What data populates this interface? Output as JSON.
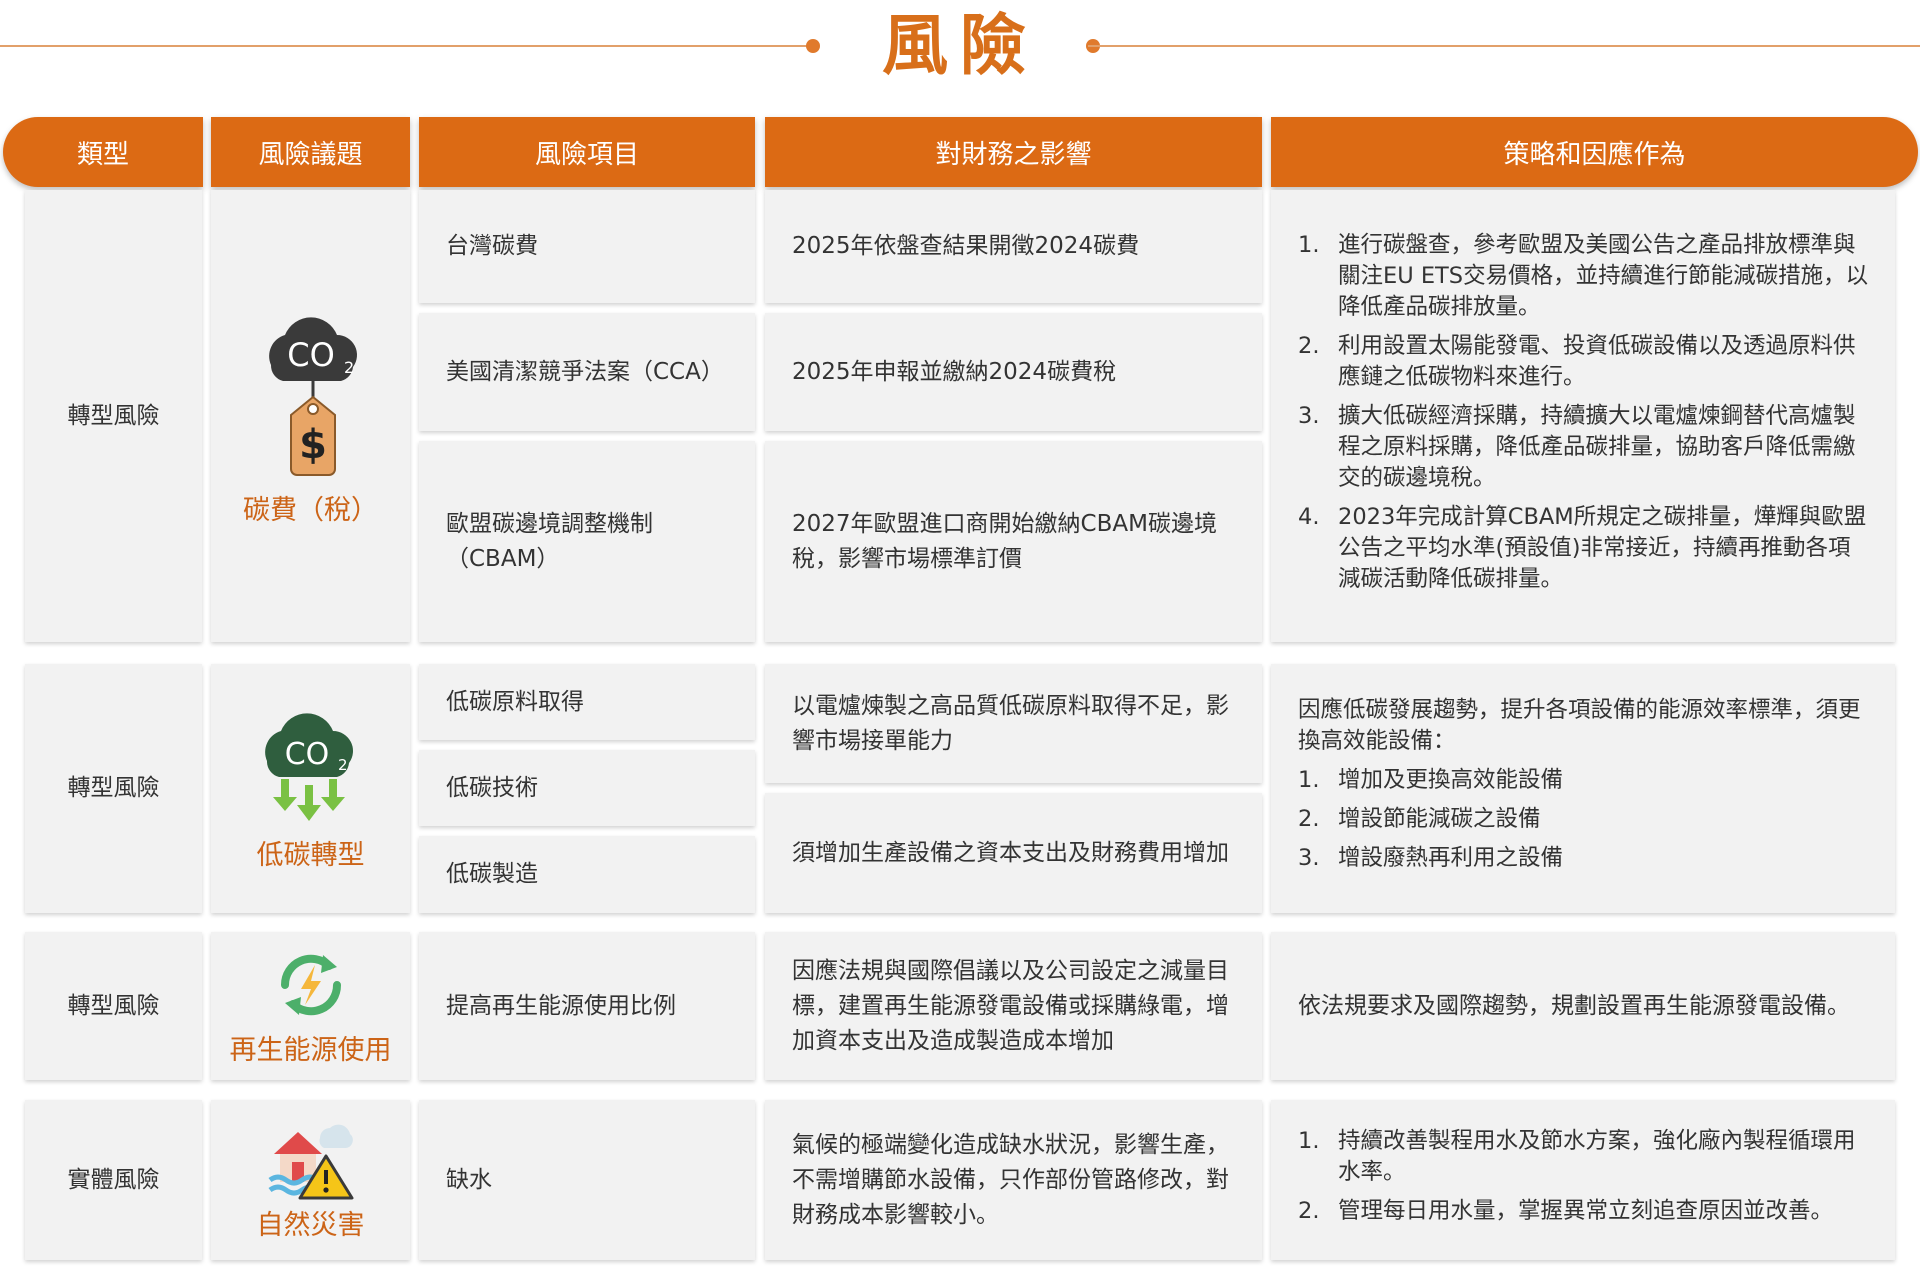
{
  "title": "風險",
  "headers": [
    "類型",
    "風險議題",
    "風險項目",
    "對財務之影響",
    "策略和因應作為"
  ],
  "groups": [
    {
      "type": "轉型風險",
      "issue": "碳費（稅）",
      "items": [
        "台灣碳費",
        "美國清潔競爭法案（CCA）",
        "歐盟碳邊境調整機制（CBAM）"
      ],
      "impacts": [
        "2025年依盤查結果開徵2024碳費",
        "2025年申報並繳納2024碳費稅",
        "2027年歐盟進口商開始繳納CBAM碳邊境稅，影響市場標準訂價"
      ],
      "strategy_items": [
        "進行碳盤查，參考歐盟及美國公告之產品排放標準與關注EU ETS交易價格，並持續進行節能減碳措施，以降低產品碳排放量。",
        "利用設置太陽能發電、投資低碳設備以及透過原料供應鏈之低碳物料來進行。",
        "擴大低碳經濟採購，持續擴大以電爐煉鋼替代高爐製程之原料採購，降低產品碳排量，協助客戶降低需繳交的碳邊境稅。",
        "2023年完成計算CBAM所規定之碳排量，燁輝與歐盟公告之平均水準(預設值)非常接近，持續再推動各項減碳活動降低碳排量。"
      ]
    },
    {
      "type": "轉型風險",
      "issue": "低碳轉型",
      "items": [
        "低碳原料取得",
        "低碳技術",
        "低碳製造"
      ],
      "impacts": [
        "以電爐煉製之高品質低碳原料取得不足，影響市場接單能力",
        "須增加生產設備之資本支出及財務費用增加"
      ],
      "strategy_intro": "因應低碳發展趨勢，提升各項設備的能源效率標準，須更換高效能設備：",
      "strategy_items": [
        "增加及更換高效能設備",
        "增設節能減碳之設備",
        "增設廢熱再利用之設備"
      ]
    },
    {
      "type": "轉型風險",
      "issue": "再生能源使用",
      "items": [
        "提高再生能源使用比例"
      ],
      "impacts": [
        "因應法規與國際倡議以及公司設定之減量目標，建置再生能源發電設備或採購綠電，增加資本支出及造成製造成本增加"
      ],
      "strategy_text": "依法規要求及國際趨勢，規劃設置再生能源發電設備。"
    },
    {
      "type": "實體風險",
      "issue": "自然災害",
      "items": [
        "缺水"
      ],
      "impacts": [
        "氣候的極端變化造成缺水狀況，影響生產，不需增購節水設備，只作部份管路修改，對財務成本影響較小。"
      ],
      "strategy_items": [
        "持續改善製程用水及節水方案，強化廠內製程循環用水率。",
        "管理每日用水量，掌握異常立刻追查原因並改善。"
      ]
    }
  ],
  "icons": {
    "co2_tag": "co2-price-tag-icon",
    "co2_down": "co2-reduction-icon",
    "renewable": "renewable-energy-icon",
    "disaster": "natural-disaster-icon"
  },
  "colors": {
    "accent": "#dc6a14",
    "label": "#cc6417",
    "cell": "#f2f2f2"
  }
}
